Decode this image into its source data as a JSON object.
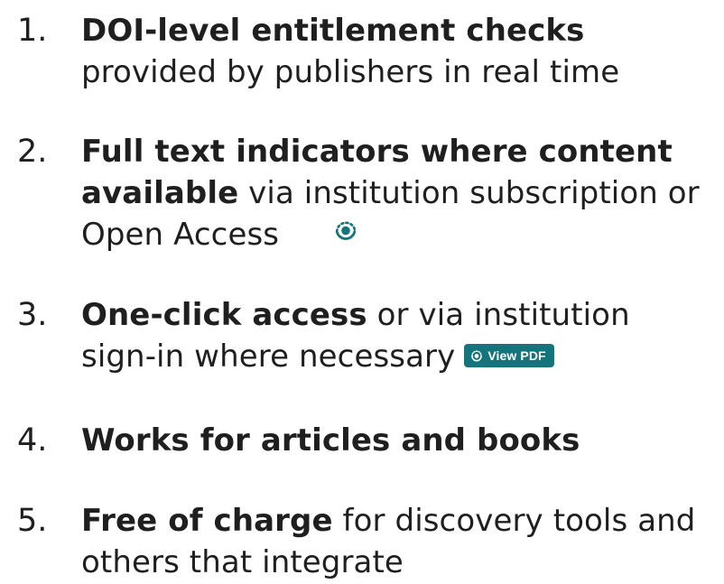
{
  "items": [
    {
      "number": "1.",
      "bold": "DOI-level entitlement checks",
      "rest_line1": "",
      "line2": "provided by publishers in real time"
    },
    {
      "number": "2.",
      "bold_line1": "Full text indicators where content",
      "bold_line2": "available",
      "rest_line2": " via institution subscription or",
      "line3": "Open Access"
    },
    {
      "number": "3.",
      "bold": "One-click access",
      "rest_line1": " or via institution",
      "line2": "sign-in where necessary",
      "badge_label": "View PDF"
    },
    {
      "number": "4.",
      "bold": "Works for articles and books"
    },
    {
      "number": "5.",
      "bold": "Free of charge",
      "rest_line1": " for discovery tools and",
      "line2": "others that integrate"
    }
  ],
  "colors": {
    "text": "#1f1f1f",
    "accent": "#13747c"
  },
  "icons": {
    "open_access": "open-access-icon",
    "badge": "open-access-icon"
  }
}
